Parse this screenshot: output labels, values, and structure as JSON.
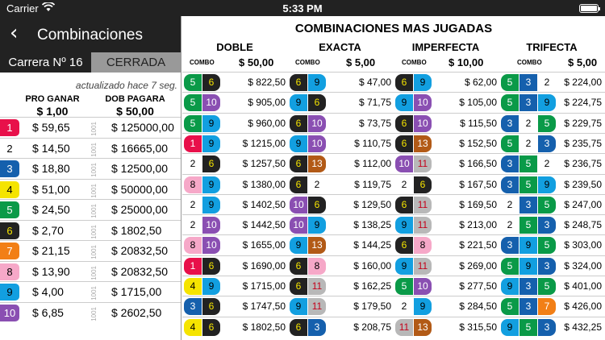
{
  "status": {
    "carrier": "Carrier",
    "time": "5:33 PM"
  },
  "nav": {
    "back": "‹",
    "title": "Combinaciones"
  },
  "race": {
    "label": "Carrera Nº 16",
    "state": "CERRADA"
  },
  "updated": "actualizado hace 7 seg.",
  "left": {
    "h1": "PRO GANAR",
    "v1": "$ 1,00",
    "h2": "DOB PAGARA",
    "v2": "$ 50,00",
    "sep": "1001",
    "rows": [
      {
        "n": "1",
        "pro": "$ 59,65",
        "dob": "$ 125000,00"
      },
      {
        "n": "2",
        "pro": "$ 14,50",
        "dob": "$ 16665,00"
      },
      {
        "n": "3",
        "pro": "$ 18,80",
        "dob": "$ 12500,00"
      },
      {
        "n": "4",
        "pro": "$ 51,00",
        "dob": "$ 50000,00"
      },
      {
        "n": "5",
        "pro": "$ 24,50",
        "dob": "$ 25000,00"
      },
      {
        "n": "6",
        "pro": "$ 2,70",
        "dob": "$ 1802,50"
      },
      {
        "n": "7",
        "pro": "$ 21,15",
        "dob": "$ 20832,50"
      },
      {
        "n": "8",
        "pro": "$ 13,90",
        "dob": "$ 20832,50"
      },
      {
        "n": "9",
        "pro": "$ 4,00",
        "dob": "$ 1715,00"
      },
      {
        "n": "10",
        "pro": "$ 6,85",
        "dob": "$ 2602,50"
      }
    ]
  },
  "right": {
    "title": "COMBINACIONES MAS JUGADAS",
    "cols": [
      {
        "name": "DOBLE",
        "combo": "COMBO",
        "price": "$ 50,00"
      },
      {
        "name": "EXACTA",
        "combo": "COMBO",
        "price": "$ 5,00"
      },
      {
        "name": "IMPERFECTA",
        "combo": "COMBO",
        "price": "$ 10,00"
      },
      {
        "name": "TRIFECTA",
        "combo": "COMBO",
        "price": "$ 5,00"
      }
    ],
    "doble": [
      {
        "c": [
          "5",
          "6"
        ],
        "a": "$ 822,50"
      },
      {
        "c": [
          "5",
          "10"
        ],
        "a": "$ 905,00"
      },
      {
        "c": [
          "5",
          "9"
        ],
        "a": "$ 960,00"
      },
      {
        "c": [
          "1",
          "9"
        ],
        "a": "$ 1215,00"
      },
      {
        "c": [
          "2",
          "6"
        ],
        "a": "$ 1257,50"
      },
      {
        "c": [
          "8",
          "9"
        ],
        "a": "$ 1380,00"
      },
      {
        "c": [
          "2",
          "9"
        ],
        "a": "$ 1402,50"
      },
      {
        "c": [
          "2",
          "10"
        ],
        "a": "$ 1442,50"
      },
      {
        "c": [
          "8",
          "10"
        ],
        "a": "$ 1655,00"
      },
      {
        "c": [
          "1",
          "6"
        ],
        "a": "$ 1690,00"
      },
      {
        "c": [
          "4",
          "9"
        ],
        "a": "$ 1715,00"
      },
      {
        "c": [
          "3",
          "6"
        ],
        "a": "$ 1747,50"
      },
      {
        "c": [
          "4",
          "6"
        ],
        "a": "$ 1802,50"
      }
    ],
    "exacta": [
      {
        "c": [
          "6",
          "9"
        ],
        "a": "$ 47,00"
      },
      {
        "c": [
          "9",
          "6"
        ],
        "a": "$ 71,75"
      },
      {
        "c": [
          "6",
          "10"
        ],
        "a": "$ 73,75"
      },
      {
        "c": [
          "9",
          "10"
        ],
        "a": "$ 110,75"
      },
      {
        "c": [
          "6",
          "13"
        ],
        "a": "$ 112,00"
      },
      {
        "c": [
          "6",
          "2"
        ],
        "a": "$ 119,75"
      },
      {
        "c": [
          "10",
          "6"
        ],
        "a": "$ 129,50"
      },
      {
        "c": [
          "10",
          "9"
        ],
        "a": "$ 138,25"
      },
      {
        "c": [
          "9",
          "13"
        ],
        "a": "$ 144,25"
      },
      {
        "c": [
          "6",
          "8"
        ],
        "a": "$ 160,00"
      },
      {
        "c": [
          "6",
          "11"
        ],
        "a": "$ 162,25"
      },
      {
        "c": [
          "9",
          "11"
        ],
        "a": "$ 179,50"
      },
      {
        "c": [
          "6",
          "3"
        ],
        "a": "$ 208,75"
      }
    ],
    "imperfecta": [
      {
        "c": [
          "6",
          "9"
        ],
        "a": "$ 62,00"
      },
      {
        "c": [
          "9",
          "10"
        ],
        "a": "$ 105,00"
      },
      {
        "c": [
          "6",
          "10"
        ],
        "a": "$ 115,50"
      },
      {
        "c": [
          "6",
          "13"
        ],
        "a": "$ 152,50"
      },
      {
        "c": [
          "10",
          "11"
        ],
        "a": "$ 166,50"
      },
      {
        "c": [
          "2",
          "6"
        ],
        "a": "$ 167,50"
      },
      {
        "c": [
          "6",
          "11"
        ],
        "a": "$ 169,50"
      },
      {
        "c": [
          "9",
          "11"
        ],
        "a": "$ 213,00"
      },
      {
        "c": [
          "6",
          "8"
        ],
        "a": "$ 221,50"
      },
      {
        "c": [
          "9",
          "11"
        ],
        "a": "$ 269,00"
      },
      {
        "c": [
          "5",
          "10"
        ],
        "a": "$ 277,50"
      },
      {
        "c": [
          "2",
          "9"
        ],
        "a": "$ 284,50"
      },
      {
        "c": [
          "11",
          "13"
        ],
        "a": "$ 315,50"
      }
    ],
    "trifecta": [
      {
        "c": [
          "5",
          "3",
          "2"
        ],
        "a": "$ 224,00"
      },
      {
        "c": [
          "5",
          "3",
          "9"
        ],
        "a": "$ 224,75"
      },
      {
        "c": [
          "3",
          "2",
          "5"
        ],
        "a": "$ 229,75"
      },
      {
        "c": [
          "5",
          "2",
          "3"
        ],
        "a": "$ 235,75"
      },
      {
        "c": [
          "3",
          "5",
          "2"
        ],
        "a": "$ 236,75"
      },
      {
        "c": [
          "3",
          "5",
          "9"
        ],
        "a": "$ 239,50"
      },
      {
        "c": [
          "2",
          "3",
          "5"
        ],
        "a": "$ 247,00"
      },
      {
        "c": [
          "2",
          "5",
          "3"
        ],
        "a": "$ 248,75"
      },
      {
        "c": [
          "3",
          "9",
          "5"
        ],
        "a": "$ 303,00"
      },
      {
        "c": [
          "5",
          "9",
          "3"
        ],
        "a": "$ 324,00"
      },
      {
        "c": [
          "9",
          "3",
          "5"
        ],
        "a": "$ 401,00"
      },
      {
        "c": [
          "5",
          "3",
          "7"
        ],
        "a": "$ 426,00"
      },
      {
        "c": [
          "9",
          "5",
          "3"
        ],
        "a": "$ 432,25"
      }
    ]
  },
  "colors": {
    "1": [
      "#e8104a",
      "#fff"
    ],
    "2": [
      "#ffffff",
      "#000"
    ],
    "3": [
      "#1560ad",
      "#fff"
    ],
    "4": [
      "#f5e400",
      "#000"
    ],
    "5": [
      "#0a9a48",
      "#fff"
    ],
    "6": [
      "#222222",
      "#f5e400"
    ],
    "7": [
      "#f27f16",
      "#fff"
    ],
    "8": [
      "#f6a8c8",
      "#000"
    ],
    "9": [
      "#129fe0",
      "#000"
    ],
    "10": [
      "#8a4fb2",
      "#fff"
    ],
    "11": [
      "#b8b8b8",
      "#c4001a"
    ],
    "13": [
      "#b25a16",
      "#fff"
    ]
  }
}
